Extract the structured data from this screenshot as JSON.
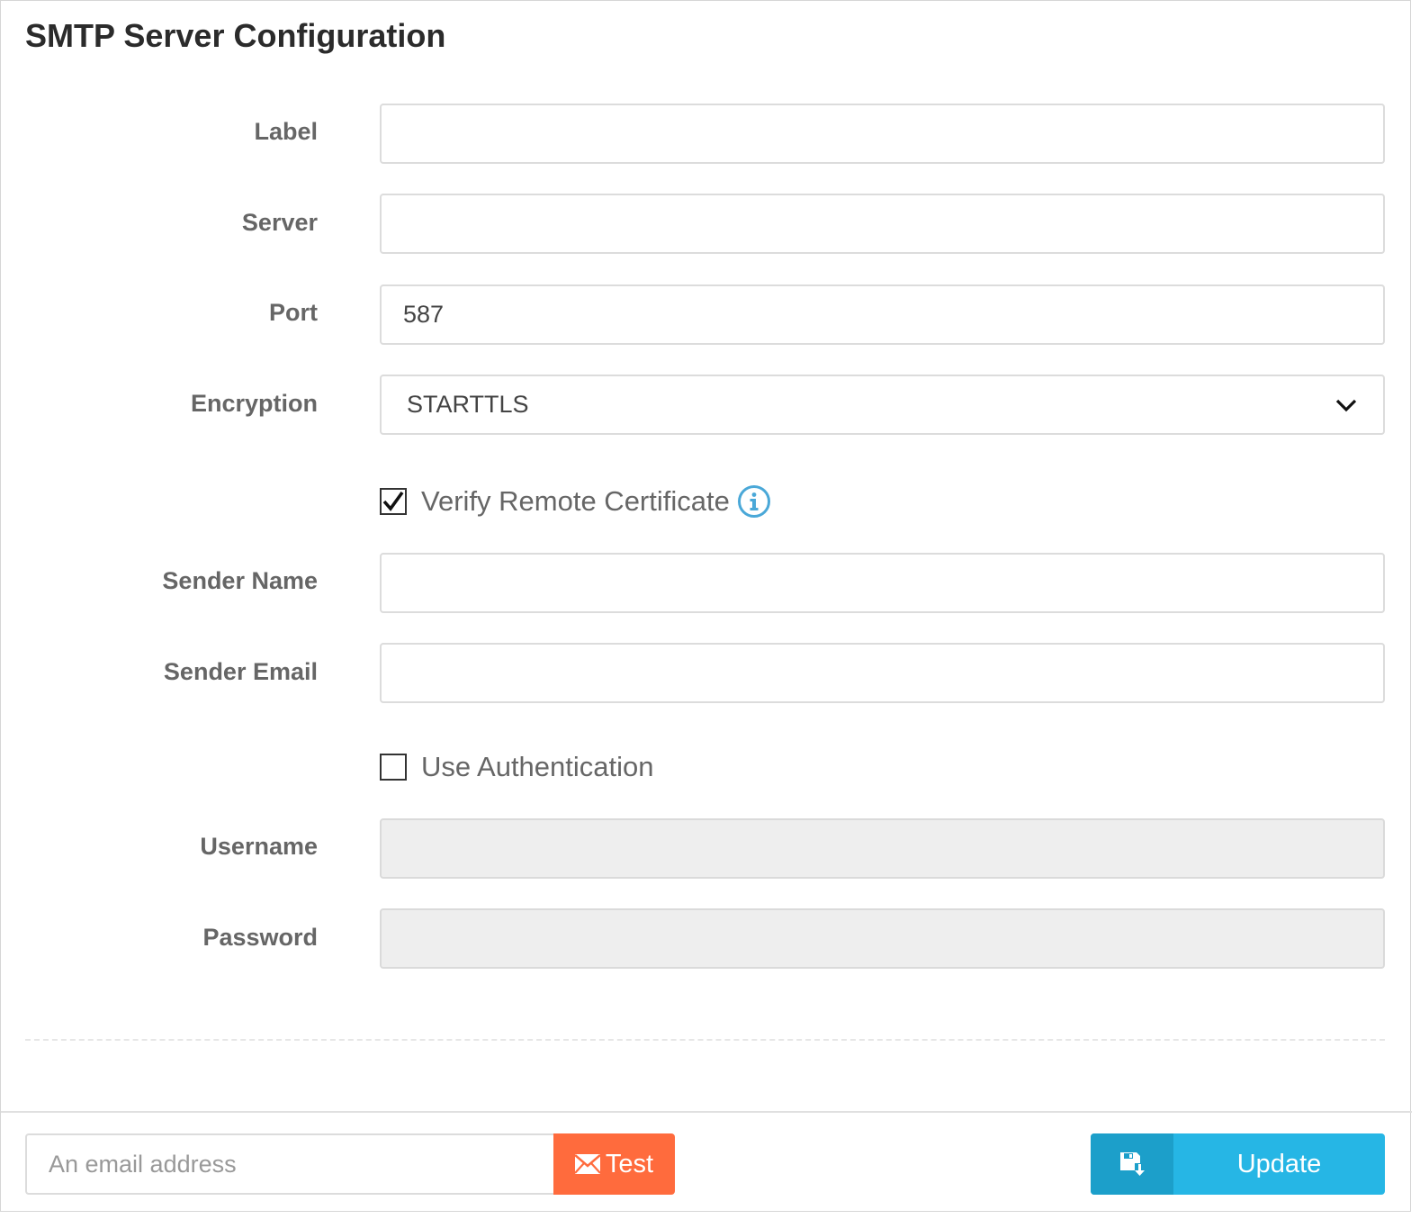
{
  "page": {
    "title": "SMTP Server Configuration"
  },
  "form": {
    "label": {
      "label": "Label",
      "value": ""
    },
    "server": {
      "label": "Server",
      "value": ""
    },
    "port": {
      "label": "Port",
      "value": "587"
    },
    "encryption": {
      "label": "Encryption",
      "selected": "STARTTLS"
    },
    "verify_certificate": {
      "label": "Verify Remote Certificate",
      "checked": true
    },
    "sender_name": {
      "label": "Sender Name",
      "value": ""
    },
    "sender_email": {
      "label": "Sender Email",
      "value": ""
    },
    "use_authentication": {
      "label": "Use Authentication",
      "checked": false
    },
    "username": {
      "label": "Username",
      "value": ""
    },
    "password": {
      "label": "Password",
      "value": ""
    }
  },
  "footer": {
    "test_email_placeholder": "An email address",
    "test_label": "Test",
    "update_label": "Update"
  },
  "colors": {
    "test_button": "#ff6b3d",
    "update_button": "#26b6e5",
    "update_icon_bg": "#1c9fca",
    "info_icon": "#4aa8d8"
  },
  "icons": {
    "info": "info-circle-icon",
    "envelope": "envelope-icon",
    "save": "save-icon",
    "chevron": "chevron-down-icon"
  }
}
